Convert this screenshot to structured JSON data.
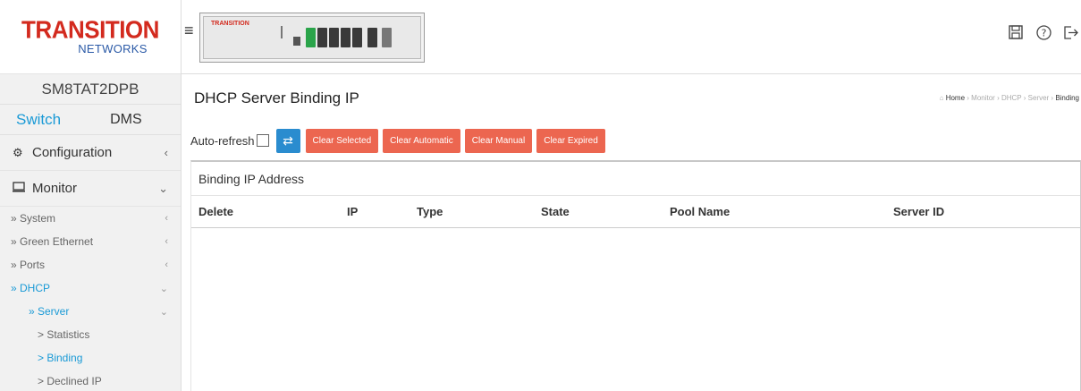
{
  "sidebar": {
    "logo_top": "TRANSITION",
    "logo_bottom": "NETWORKS",
    "device": "SM8TAT2DPB",
    "tab_switch": "Switch",
    "tab_dms": "DMS",
    "configuration": "Configuration",
    "monitor": "Monitor",
    "items": [
      {
        "label": "» System"
      },
      {
        "label": "» Green Ethernet"
      },
      {
        "label": "» Ports"
      },
      {
        "label": "» DHCP"
      },
      {
        "label": "» Server"
      },
      {
        "label": "> Statistics"
      },
      {
        "label": "> Binding"
      },
      {
        "label": "> Declined IP"
      }
    ]
  },
  "topbar": {
    "brand": "TRANSITION"
  },
  "main": {
    "title": "DHCP Server Binding IP",
    "breadcrumb": {
      "home": "Home",
      "c1": "Monitor",
      "c2": "DHCP",
      "c3": "Server",
      "current": "Binding"
    },
    "auto_refresh": "Auto-refresh",
    "buttons": {
      "clear_selected": "Clear Selected",
      "clear_automatic": "Clear Automatic",
      "clear_manual": "Clear Manual",
      "clear_expired": "Clear Expired"
    },
    "panel_title": "Binding IP Address",
    "columns": [
      "Delete",
      "IP",
      "Type",
      "State",
      "Pool Name",
      "Server ID"
    ]
  },
  "colors": {
    "accent": "#1a9ad6",
    "button_red": "#ec6650",
    "refresh_blue": "#2a8ccf",
    "logo_red": "#d32a1e"
  }
}
